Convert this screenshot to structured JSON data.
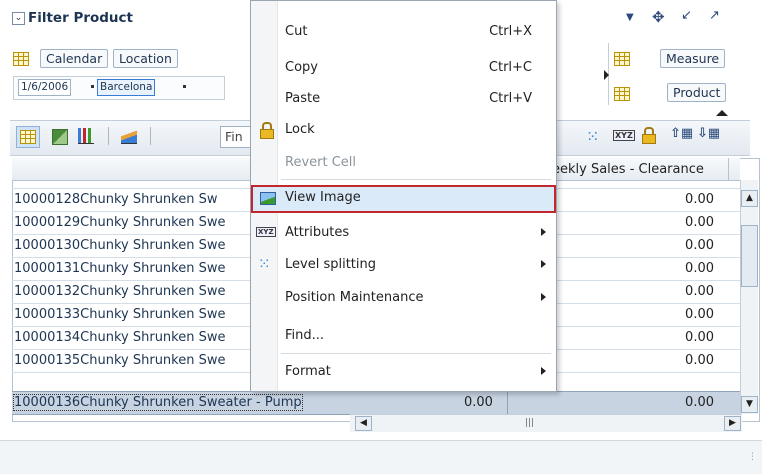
{
  "filter_panel": {
    "title": "Filter Product"
  },
  "dimension_buttons": {
    "calendar": "Calendar",
    "location": "Location",
    "measure": "Measure",
    "product": "Product"
  },
  "filter_chips": {
    "date": "1/6/2006",
    "location": "Barcelona"
  },
  "toolbar": {
    "find_placeholder": "Fin"
  },
  "grid": {
    "column_header": "eekly Sales - Clearance",
    "rows": [
      {
        "name": "10000128Chunky Shrunken Sw",
        "value": "0.00"
      },
      {
        "name": "10000129Chunky Shrunken Swe",
        "value": "0.00"
      },
      {
        "name": "10000130Chunky Shrunken Swe",
        "value": "0.00"
      },
      {
        "name": "10000131Chunky Shrunken Swe",
        "value": "0.00"
      },
      {
        "name": "10000132Chunky Shrunken Swe",
        "value": "0.00"
      },
      {
        "name": "10000133Chunky Shrunken Swe",
        "value": "0.00"
      },
      {
        "name": "10000134Chunky Shrunken Swe",
        "value": "0.00"
      },
      {
        "name": "10000135Chunky Shrunken Swe",
        "value": "0.00"
      }
    ],
    "selected_row": {
      "name": "10000136Chunky Shrunken Sweater - Pump",
      "value1": "0.00",
      "value2": "0.00"
    }
  },
  "context_menu": {
    "cut": {
      "label": "Cut",
      "shortcut": "Ctrl+X"
    },
    "copy": {
      "label": "Copy",
      "shortcut": "Ctrl+C"
    },
    "paste": {
      "label": "Paste",
      "shortcut": "Ctrl+V"
    },
    "lock": {
      "label": "Lock"
    },
    "revert_cell": {
      "label": "Revert Cell"
    },
    "view_image": {
      "label": "View Image"
    },
    "attributes": {
      "label": "Attributes"
    },
    "level_splitting": {
      "label": "Level splitting"
    },
    "position_maintenance": {
      "label": "Position Maintenance"
    },
    "find": {
      "label": "Find..."
    },
    "format": {
      "label": "Format"
    }
  },
  "colors": {
    "accent": "#3a7bd5",
    "highlight_border": "#c0282d",
    "selected_row": "#c7d3e1"
  }
}
